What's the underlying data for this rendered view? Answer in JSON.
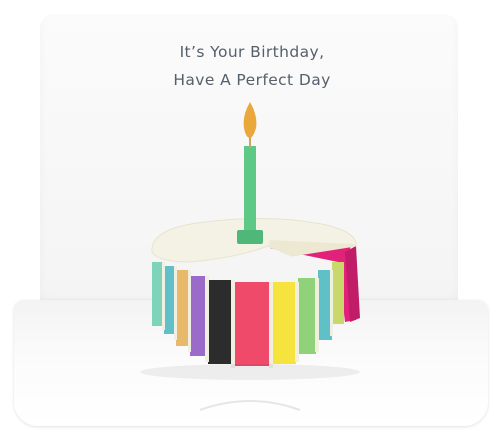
{
  "card": {
    "greeting_line1": "It’s Your Birthday,",
    "greeting_line2": "Have A Perfect Day"
  },
  "colors": {
    "text": "#56606b",
    "candle": "#5ec987",
    "flame": "#e9a73c",
    "cake_top": "#f4f2e4",
    "slice_pink": "#e2227a",
    "stripes": [
      "#7fd3b8",
      "#5fc1c7",
      "#e8b86b",
      "#9b6bc9",
      "#2c2c2c",
      "#ef4a6a",
      "#f6e33d",
      "#8fd27a",
      "#5fc1c7",
      "#c8d86b"
    ]
  }
}
